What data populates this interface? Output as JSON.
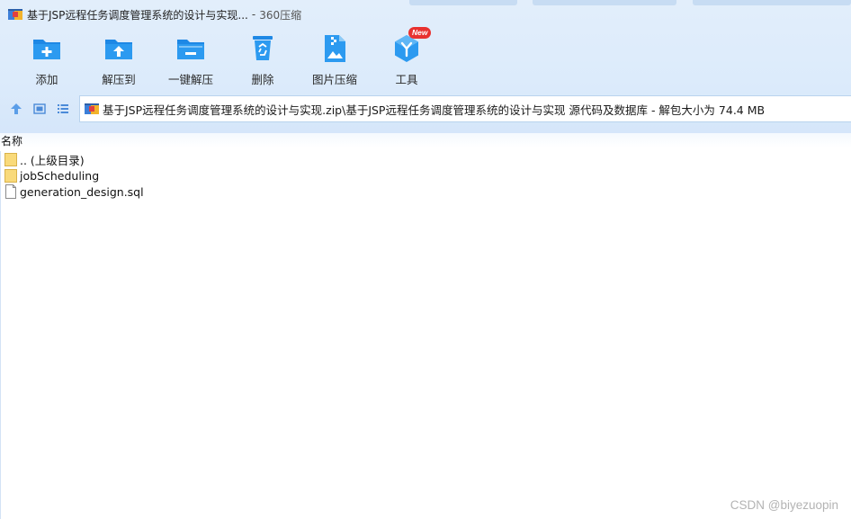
{
  "window": {
    "title": "基于JSP远程任务调度管理系统的设计与实现...",
    "separator": "-",
    "app_name": "360压缩"
  },
  "toolbar": {
    "items": [
      {
        "label": "添加",
        "icon": "add-folder-icon"
      },
      {
        "label": "解压到",
        "icon": "extract-to-icon"
      },
      {
        "label": "一键解压",
        "icon": "one-click-extract-icon"
      },
      {
        "label": "删除",
        "icon": "recycle-bin-icon"
      },
      {
        "label": "图片压缩",
        "icon": "image-compress-icon"
      },
      {
        "label": "工具",
        "icon": "tools-cube-icon",
        "badge": "New"
      }
    ]
  },
  "nav": {
    "path": "基于JSP远程任务调度管理系统的设计与实现.zip\\基于JSP远程任务调度管理系统的设计与实现 源代码及数据库",
    "size_info": "- 解包大小为 74.4 MB"
  },
  "list": {
    "column_name": "名称",
    "rows": [
      {
        "name": ".. (上级目录)",
        "type": "folder"
      },
      {
        "name": "jobScheduling",
        "type": "folder"
      },
      {
        "name": "generation_design.sql",
        "type": "file"
      }
    ]
  },
  "watermark": "CSDN @biyezuopin",
  "colors": {
    "accent_blue": "#1e88e5",
    "chrome_bg": "#dcebfb",
    "badge_red": "#e8312f",
    "folder_yellow": "#f9da7a"
  }
}
